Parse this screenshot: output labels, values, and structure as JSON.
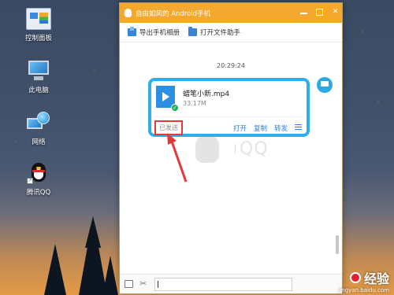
{
  "desktop": {
    "icons": [
      {
        "label": "控制面板"
      },
      {
        "label": "此电脑"
      },
      {
        "label": "网络"
      },
      {
        "label": "腾讯QQ"
      }
    ]
  },
  "window": {
    "title": "自由如风的 Android手机",
    "toolbar": {
      "export_album": "导出手机相册",
      "open_file_helper": "打开文件助手"
    },
    "chat": {
      "timestamp": "20:29:24",
      "message": {
        "file_name": "蜡笔小新.mp4",
        "file_size": "33.17M",
        "status": "已发送",
        "actions": [
          "打开",
          "复制",
          "转发"
        ]
      },
      "watermark_text": "QQ"
    }
  },
  "site_watermark": {
    "brand": "经验",
    "url": "jingyan.baidu.com"
  },
  "colors": {
    "titlebar": "#f4a82f",
    "bubble_border": "#2faee8",
    "highlight_red": "#e23a3a",
    "link_blue": "#2a7ed8"
  }
}
